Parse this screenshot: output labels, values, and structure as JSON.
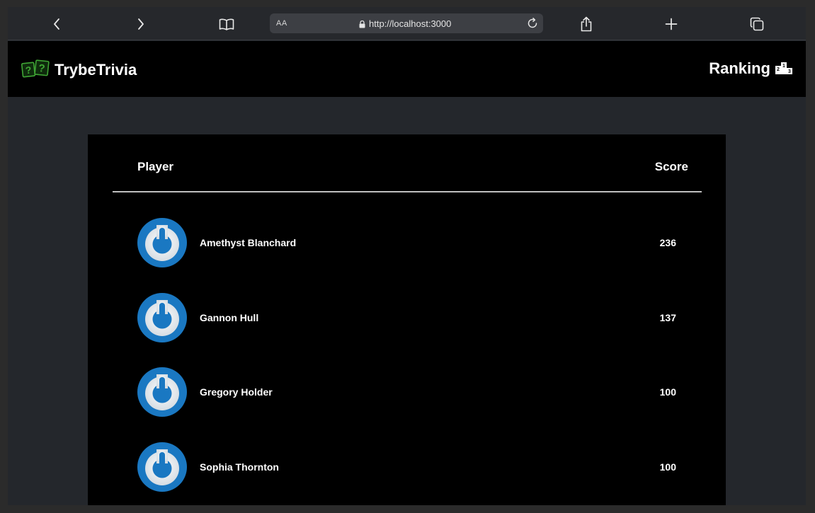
{
  "browser": {
    "url_aa": "AA",
    "url": "http://localhost:3000"
  },
  "header": {
    "brand": "TrybeTrivia",
    "ranking": "Ranking"
  },
  "table": {
    "col_player": "Player",
    "col_score": "Score",
    "rows": [
      {
        "name": "Amethyst Blanchard",
        "score": "236"
      },
      {
        "name": "Gannon Hull",
        "score": "137"
      },
      {
        "name": "Gregory Holder",
        "score": "100"
      },
      {
        "name": "Sophia Thornton",
        "score": "100"
      }
    ]
  },
  "colors": {
    "avatar_blue": "#1a78c2",
    "logo_green": "#3fa535",
    "panel_bg": "#000000",
    "page_bg": "#24272c"
  },
  "icons": {
    "back": "chevron-left-icon",
    "forward": "chevron-right-icon",
    "reader": "book-icon",
    "lock": "lock-icon",
    "reload": "reload-icon",
    "share": "share-icon",
    "new_tab": "plus-icon",
    "tabs": "tabs-icon",
    "logo": "question-cards-icon",
    "podium": "podium-icon",
    "avatar": "power-avatar-icon"
  }
}
